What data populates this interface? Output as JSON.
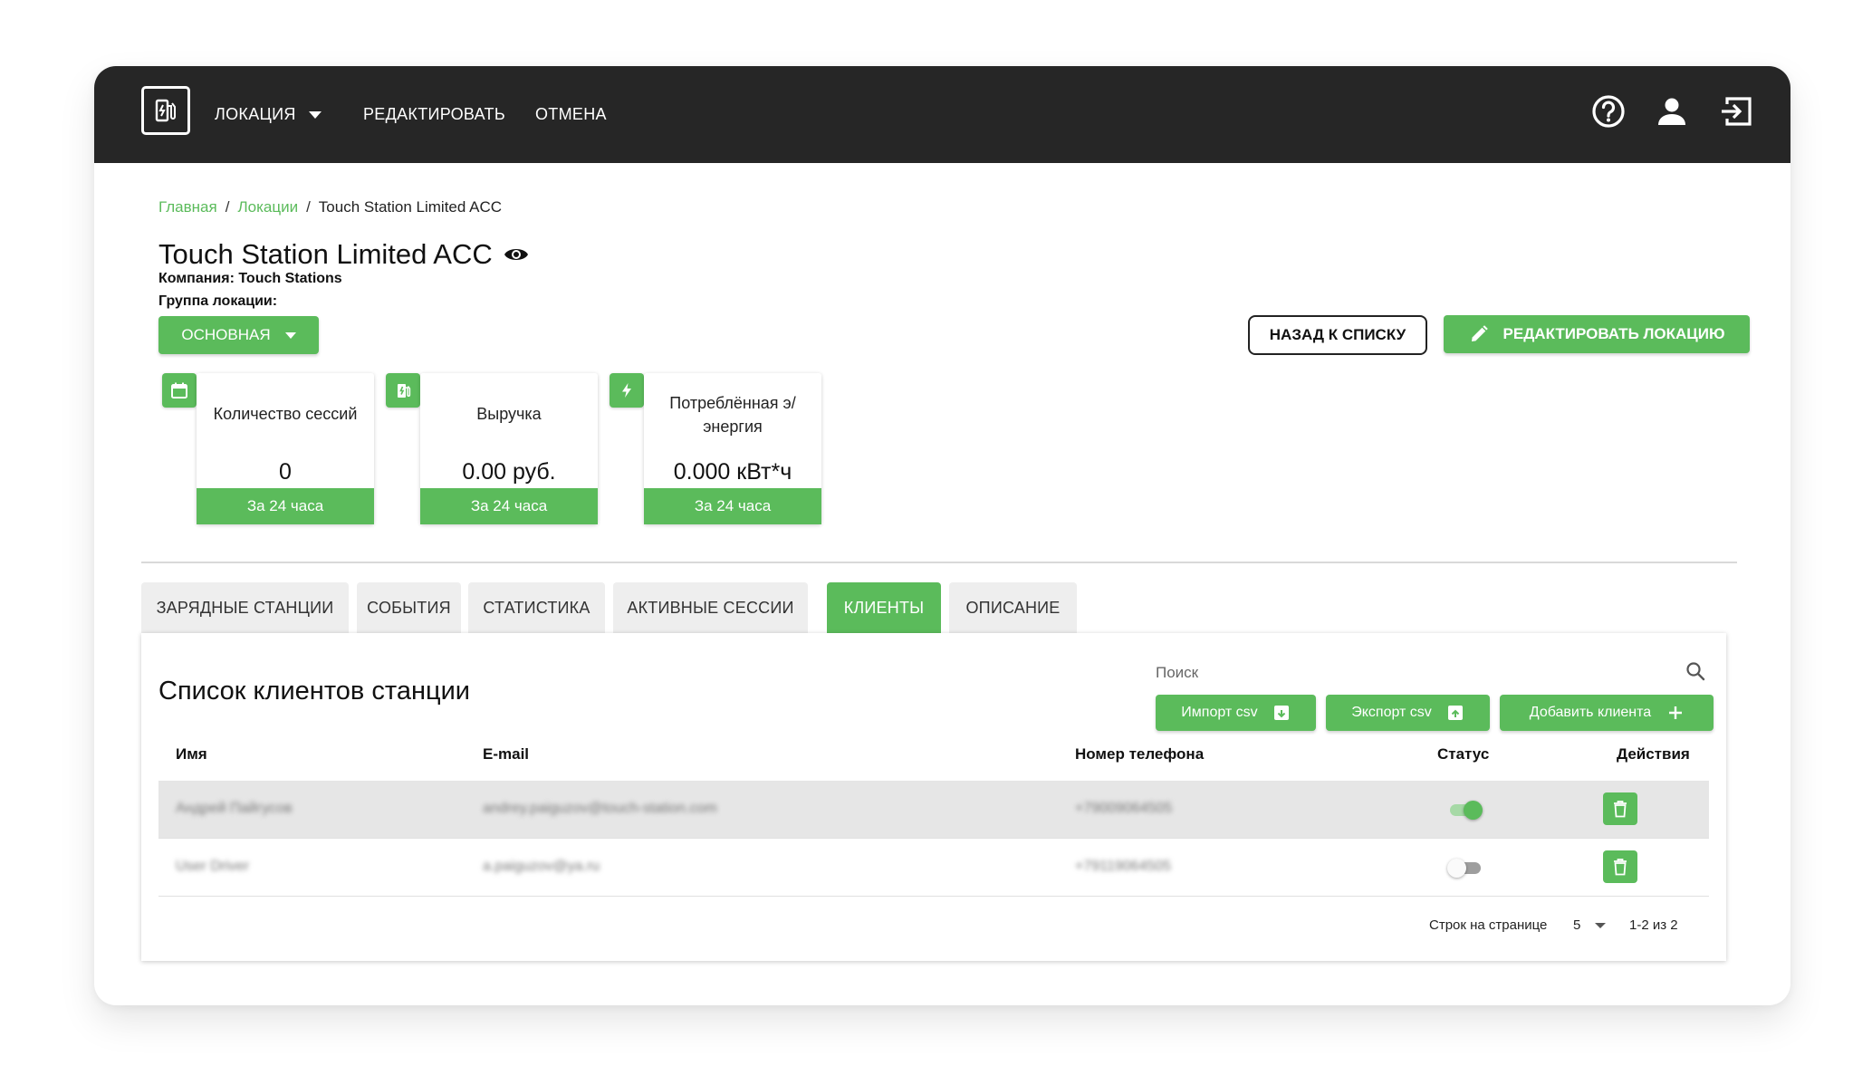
{
  "colors": {
    "accent": "#5bbb5b",
    "topbar": "#262626",
    "tab_inactive": "#eeeeee"
  },
  "nav": {
    "location": "ЛОКАЦИЯ",
    "edit": "РЕДАКТИРОВАТЬ",
    "cancel": "ОТМЕНА",
    "icons": [
      "help-icon",
      "user-icon",
      "logout-icon"
    ]
  },
  "breadcrumb": {
    "home": "Главная",
    "locations": "Локации",
    "current": "Touch Station Limited ACC"
  },
  "page": {
    "title": "Touch Station Limited ACC",
    "company": "Компания: Touch Stations",
    "group_label": "Группа локации:",
    "group_value": "ОСНОВНАЯ",
    "back_button": "НАЗАД К СПИСКУ",
    "edit_button": "РЕДАКТИРОВАТЬ ЛОКАЦИЮ"
  },
  "stats": [
    {
      "icon": "calendar-icon",
      "title": "Количество сессий",
      "value": "0",
      "period": "За 24 часа"
    },
    {
      "icon": "fuel-station-icon",
      "title": "Выручка",
      "value": "0.00 руб.",
      "period": "За 24 часа"
    },
    {
      "icon": "lightning-icon",
      "title": "Потреблённая э/энергия",
      "value": "0.000 кВт*ч",
      "period": "За 24 часа"
    }
  ],
  "tabs": [
    "ЗАРЯДНЫЕ СТАНЦИИ",
    "СОБЫТИЯ",
    "СТАТИСТИКА",
    "АКТИВНЫЕ СЕССИИ",
    "КЛИЕНТЫ",
    "ОПИСАНИЕ"
  ],
  "active_tab": "КЛИЕНТЫ",
  "clients": {
    "title": "Список клиентов станции",
    "search_placeholder": "Поиск",
    "import_button": "Импорт csv",
    "export_button": "Экспорт csv",
    "add_button": "Добавить клиента",
    "columns": {
      "name": "Имя",
      "email": "E-mail",
      "phone": "Номер телефона",
      "status": "Статус",
      "actions": "Действия"
    },
    "rows": [
      {
        "name": "Андрей Пайгусов",
        "email": "andrey.paiguzov@touch-station.com",
        "phone": "+79009064505",
        "status": true
      },
      {
        "name": "User Driver",
        "email": "a.paiguzov@ya.ru",
        "phone": "+79119064505",
        "status": false
      }
    ],
    "pagination": {
      "rows_label": "Строк на странице",
      "rows_value": "5",
      "range": "1-2 из 2"
    }
  }
}
